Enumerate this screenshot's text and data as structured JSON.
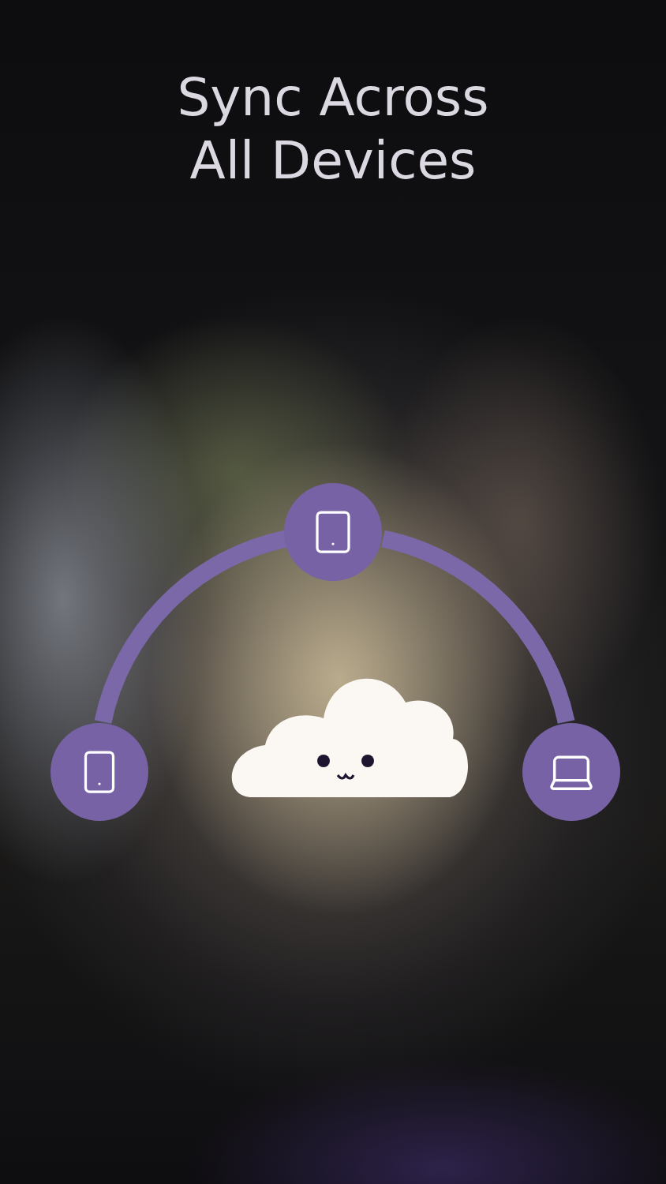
{
  "title_lines": [
    "Sync Across",
    "All Devices"
  ],
  "devices": [
    {
      "kind": "phone"
    },
    {
      "kind": "tablet"
    },
    {
      "kind": "laptop"
    }
  ]
}
